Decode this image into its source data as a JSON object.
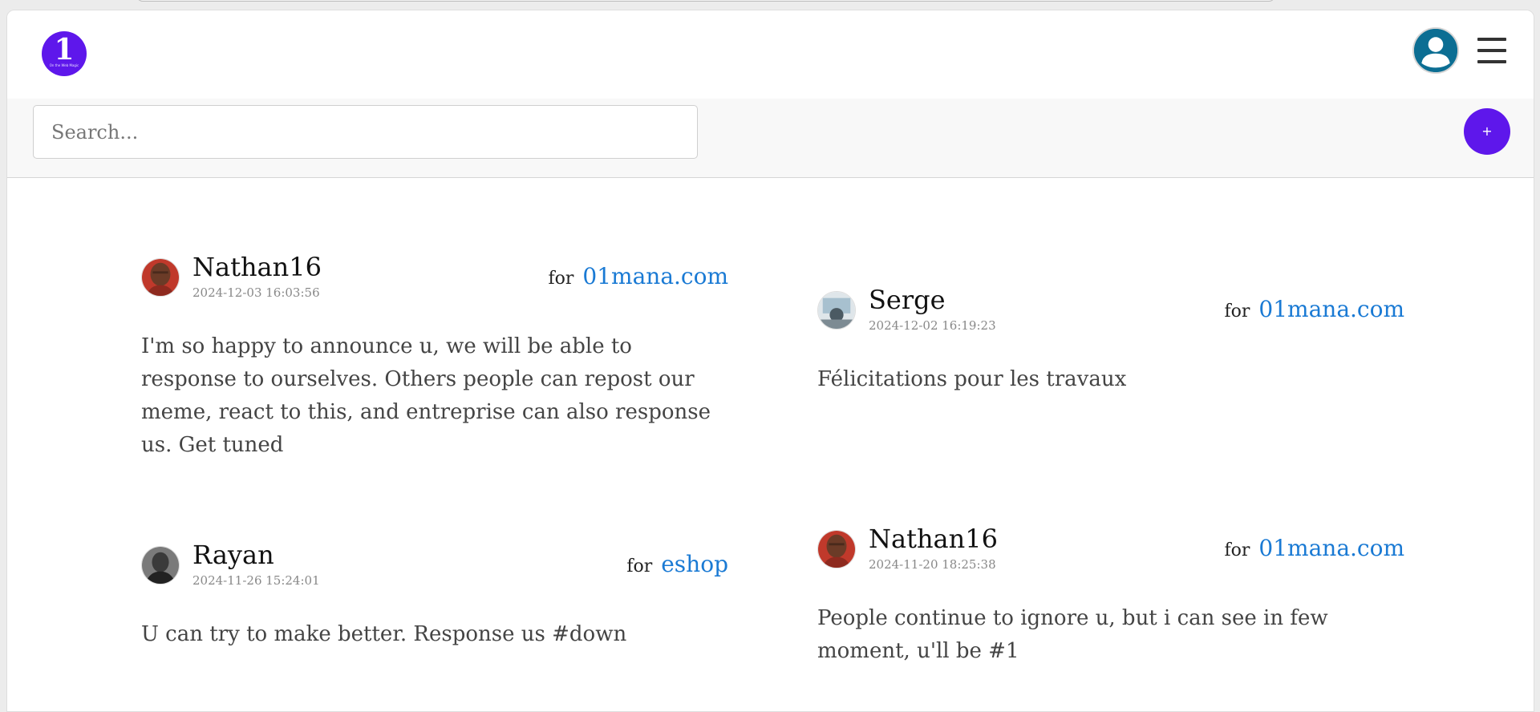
{
  "header": {
    "logo": {
      "text": "1",
      "tagline": "On the Web Magic"
    },
    "menu_icon": "hamburger-menu-icon",
    "avatar_icon": "user-account-icon"
  },
  "toolbar": {
    "search_placeholder": "Search...",
    "add_label": "+"
  },
  "posts": [
    {
      "user": "Nathan16",
      "date": "2024-12-03 16:03:56",
      "for_label": "for",
      "target": "01mana.com",
      "body": "I'm so happy to announce u, we will be able to response to ourselves. Others people can repost our meme, react to this, and entreprise can also response us. Get tuned"
    },
    {
      "user": "Serge",
      "date": "2024-12-02 16:19:23",
      "for_label": "for",
      "target": "01mana.com",
      "body": "Félicitations pour les travaux"
    },
    {
      "user": "Rayan",
      "date": "2024-11-26 15:24:01",
      "for_label": "for",
      "target": "eshop",
      "body": "U can try to make better. Response us #down"
    },
    {
      "user": "Nathan16",
      "date": "2024-11-20 18:25:38",
      "for_label": "for",
      "target": "01mana.com",
      "body": "People continue to ignore u, but i can see in few moment, u'll be #1"
    }
  ],
  "colors": {
    "brand": "#5e17eb",
    "link": "#1a7ad4",
    "avatar_bg": "#0c6e93"
  }
}
